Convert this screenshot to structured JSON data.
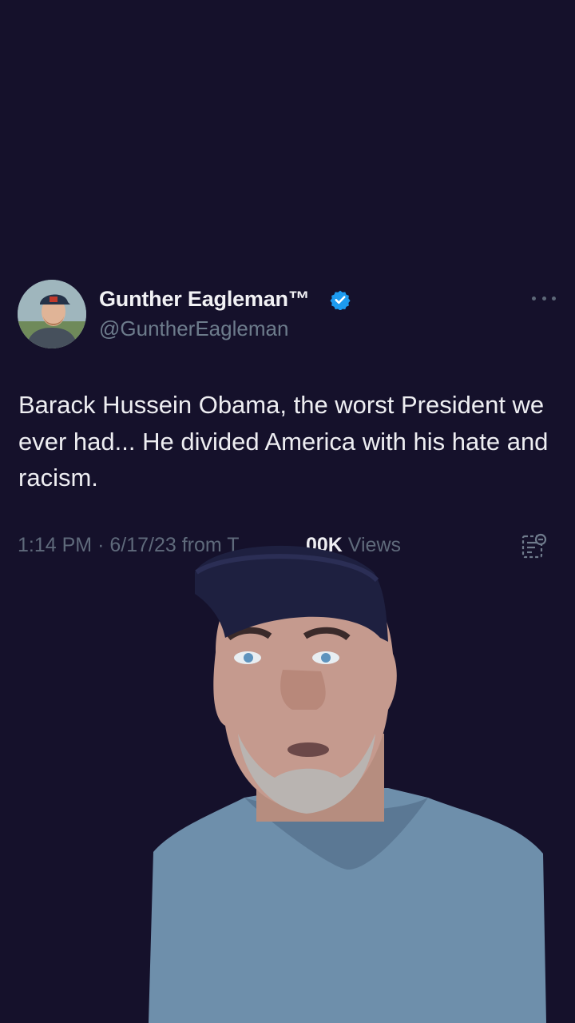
{
  "tweet": {
    "display_name": "Gunther Eagleman™",
    "handle": "@GuntherEagleman",
    "text": "Barack Hussein Obama, the worst President we ever had...  He divided America with his hate and racism.",
    "time": "1:14 PM",
    "separator": "·",
    "date": "6/17/23",
    "source_prefix": "from",
    "source_partial": "T",
    "views_count": "00K",
    "views_label": "Views"
  },
  "icons": {
    "verified": "verified-badge-icon",
    "more": "more-options-icon",
    "analytics": "analytics-icon"
  },
  "colors": {
    "background": "#15112b",
    "verified": "#1d9bf0",
    "secondary_text": "#6d7c8c"
  }
}
